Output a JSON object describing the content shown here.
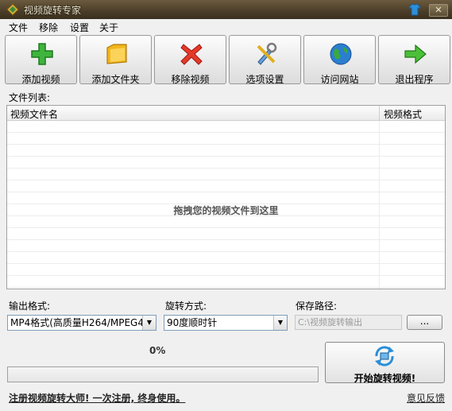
{
  "window": {
    "title": "视频旋转专家",
    "close_label": "✕"
  },
  "menu": [
    "文件",
    "移除",
    "设置",
    "关于"
  ],
  "toolbar": [
    {
      "label": "添加视频",
      "icon": "plus-icon"
    },
    {
      "label": "添加文件夹",
      "icon": "folder-icon"
    },
    {
      "label": "移除视频",
      "icon": "delete-x-icon"
    },
    {
      "label": "选项设置",
      "icon": "tools-icon"
    },
    {
      "label": "访问网站",
      "icon": "globe-icon"
    },
    {
      "label": "退出程序",
      "icon": "exit-arrow-icon"
    }
  ],
  "file_list": {
    "label": "文件列表:",
    "columns": [
      "视频文件名",
      "视频格式"
    ],
    "drop_hint": "拖拽您的视频文件到这里"
  },
  "output_format": {
    "label": "输出格式:",
    "value": "MP4格式(高质量H264/MPEG4)"
  },
  "rotation": {
    "label": "旋转方式:",
    "value": "90度顺时针"
  },
  "save_path": {
    "label": "保存路径:",
    "value": "C:\\视频旋转输出",
    "browse": "..."
  },
  "progress": {
    "percent_text": "0%",
    "value": 0
  },
  "start_button": {
    "label": "开始旋转视频!"
  },
  "footer": {
    "register_text": "注册视频旋转大师! 一次注册, 终身使用。",
    "feedback": "意见反馈"
  },
  "colors": {
    "title_bar": "#4a3d28",
    "accent_green": "#3c9a3c"
  }
}
